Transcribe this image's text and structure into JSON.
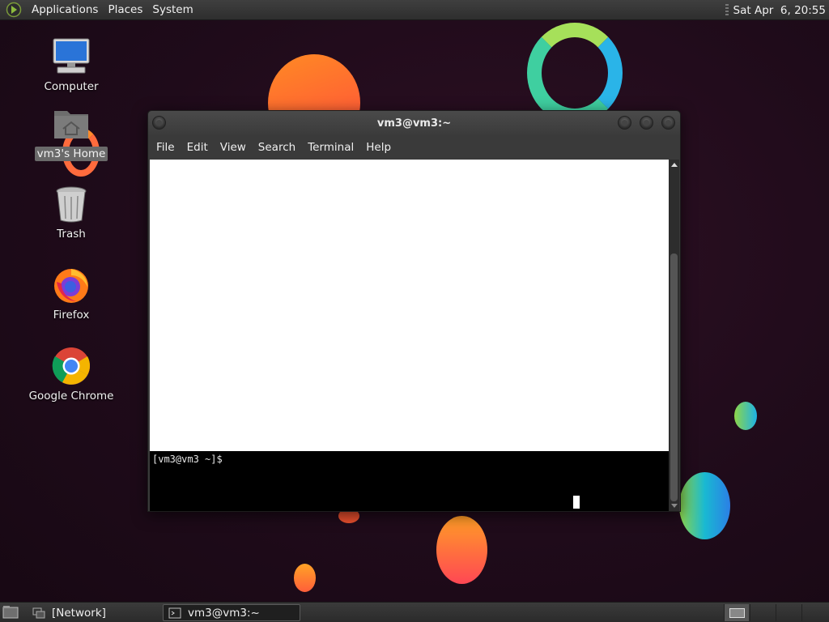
{
  "top_panel": {
    "menus": [
      "Applications",
      "Places",
      "System"
    ],
    "clock": "Sat Apr  6, 20:55"
  },
  "desktop": {
    "icons": [
      {
        "label": "Computer",
        "icon": "computer-icon"
      },
      {
        "label": "vm3's Home",
        "icon": "home-folder-icon",
        "selected": true
      },
      {
        "label": "Trash",
        "icon": "trash-icon"
      },
      {
        "label": "Firefox",
        "icon": "firefox-icon"
      },
      {
        "label": "Google Chrome",
        "icon": "chrome-icon"
      }
    ]
  },
  "terminal": {
    "title": "vm3@vm3:~",
    "menu": [
      "File",
      "Edit",
      "View",
      "Search",
      "Terminal",
      "Help"
    ],
    "prompt": "[vm3@vm3 ~]$"
  },
  "bottom_panel": {
    "tasks": [
      {
        "label": "[Network]",
        "icon": "network-window-icon",
        "active": false
      },
      {
        "label": "vm3@vm3:~",
        "icon": "terminal-icon",
        "active": true
      }
    ]
  },
  "colors": {
    "desktop_bg": "#1f0b1a",
    "panel_bg": "#333333",
    "terminal_bg": "#000000"
  }
}
